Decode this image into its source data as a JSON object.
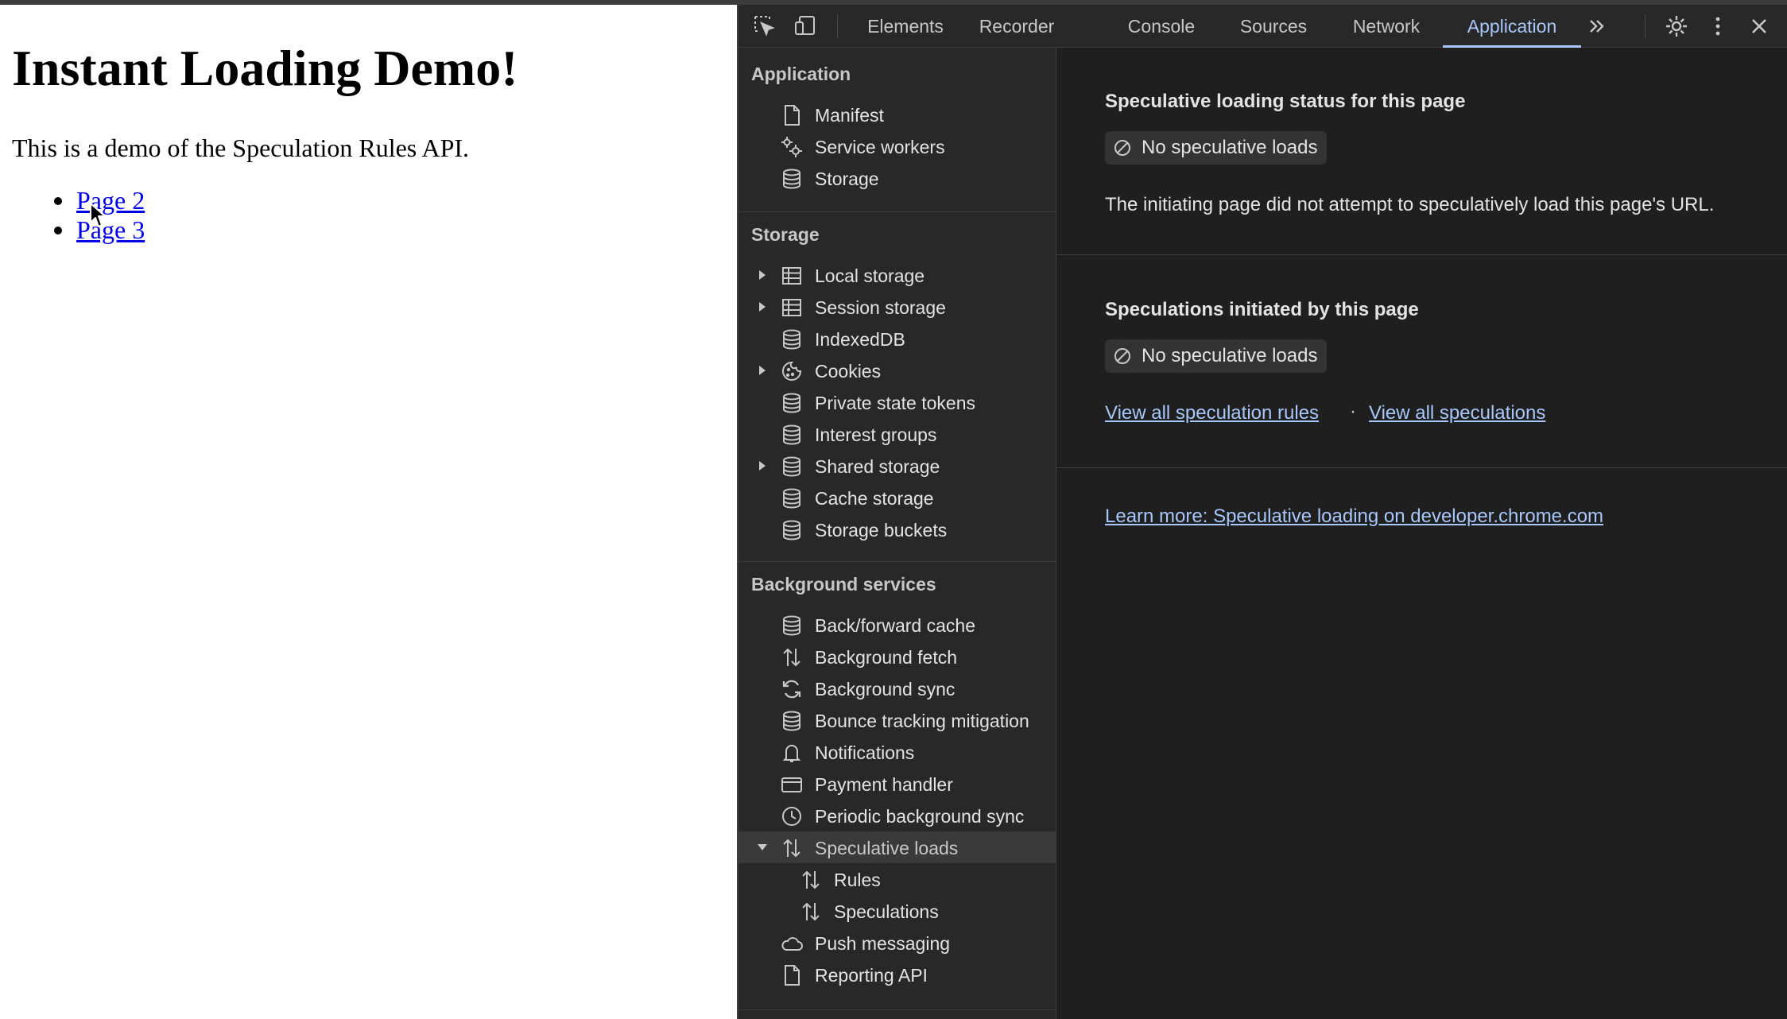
{
  "webpage": {
    "heading": "Instant Loading Demo!",
    "description": "This is a demo of the Speculation Rules API.",
    "links": [
      "Page 2",
      "Page 3"
    ]
  },
  "devtools": {
    "tabs": [
      "Elements",
      "Recorder",
      "Console",
      "Sources",
      "Network",
      "Application"
    ],
    "active_tab": "Application",
    "accent_color": "#a8c7fa",
    "sidebar": {
      "application": {
        "header": "Application",
        "items": [
          "Manifest",
          "Service workers",
          "Storage"
        ]
      },
      "storage": {
        "header": "Storage",
        "items": [
          "Local storage",
          "Session storage",
          "IndexedDB",
          "Cookies",
          "Private state tokens",
          "Interest groups",
          "Shared storage",
          "Cache storage",
          "Storage buckets"
        ]
      },
      "background": {
        "header": "Background services",
        "items": [
          "Back/forward cache",
          "Background fetch",
          "Background sync",
          "Bounce tracking mitigation",
          "Notifications",
          "Payment handler",
          "Periodic background sync",
          "Speculative loads",
          "Rules",
          "Speculations",
          "Push messaging",
          "Reporting API"
        ]
      }
    },
    "main": {
      "status_title": "Speculative loading status for this page",
      "status_badge": "No speculative loads",
      "status_message": "The initiating page did not attempt to speculatively load this page's URL.",
      "initiated_title": "Speculations initiated by this page",
      "initiated_badge": "No speculative loads",
      "link_rules": "View all speculation rules",
      "link_separator": "·",
      "link_speculations": "View all speculations",
      "learn_more": "Learn more: Speculative loading on developer.chrome.com"
    }
  }
}
